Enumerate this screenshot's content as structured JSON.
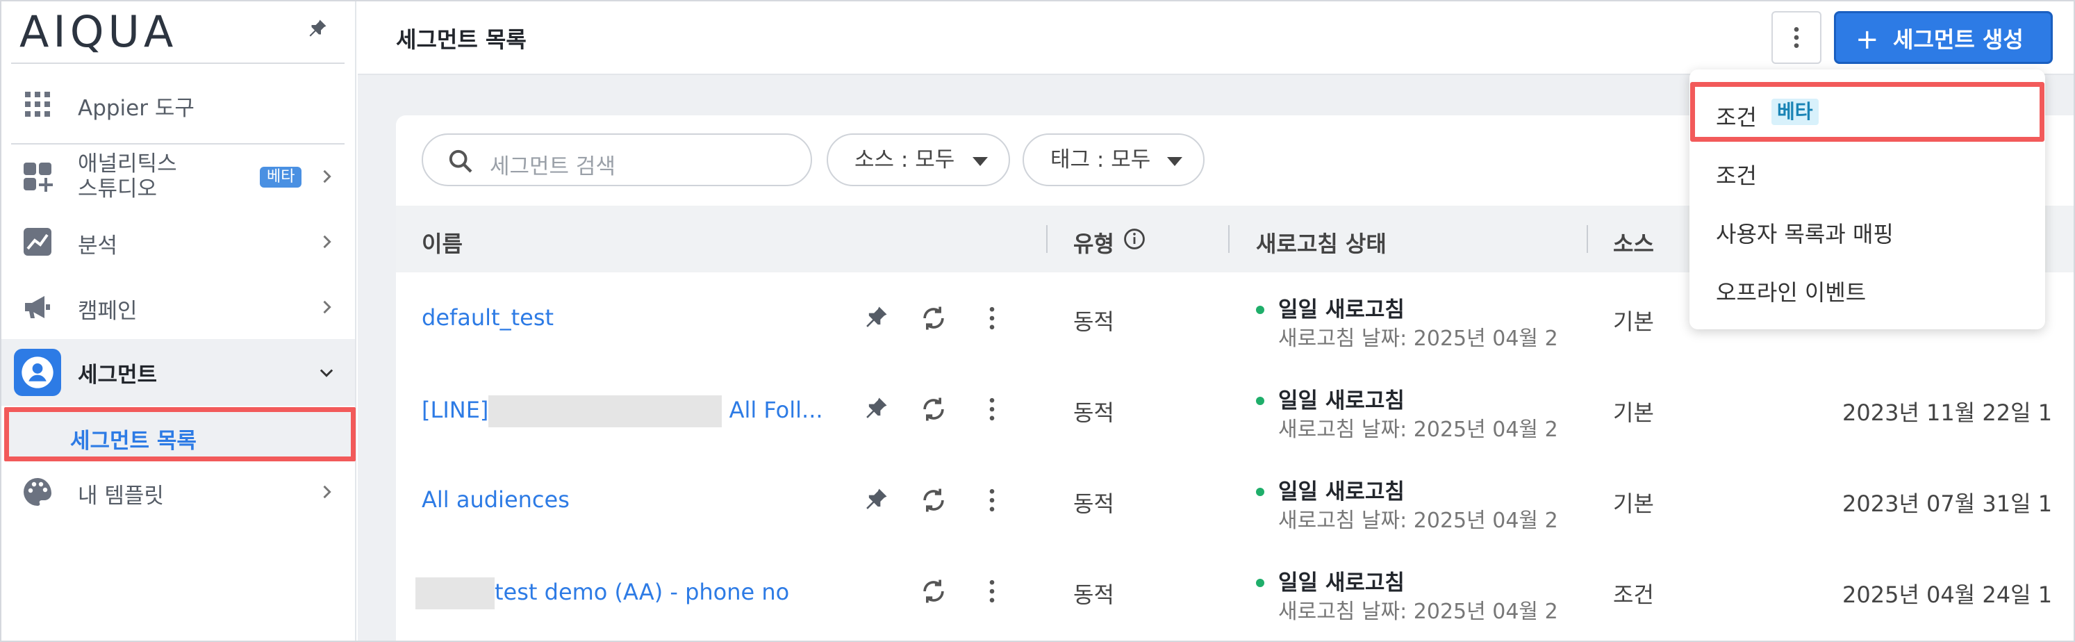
{
  "app": {
    "logo": "AIQUA"
  },
  "sidebar": {
    "items": [
      {
        "label": "Appier 도구"
      },
      {
        "label_line1": "애널리틱스",
        "label_line2": "스튜디오",
        "badge": "베타"
      },
      {
        "label": "분석"
      },
      {
        "label": "캠페인"
      },
      {
        "label": "세그먼트"
      },
      {
        "label": "내 템플릿"
      }
    ],
    "sub_items": [
      {
        "label": "세그먼트 목록"
      }
    ]
  },
  "header": {
    "title": "세그먼트 목록",
    "create_label": "세그먼트 생성",
    "create_icon": "+"
  },
  "filters": {
    "search_placeholder": "세그먼트 검색",
    "source": "소스 : 모두",
    "tag": "태그 : 모두"
  },
  "table": {
    "columns": [
      "이름",
      "유형",
      "새로고침 상태",
      "소스"
    ],
    "rows": [
      {
        "name": "default_test",
        "type": "동적",
        "status": "일일 새로고침",
        "date": "새로고침 날짜: 2025년 04월 2",
        "source": "기본",
        "created": ""
      },
      {
        "name_prefix": "[LINE]",
        "name_suffix": " All Foll...",
        "type": "동적",
        "status": "일일 새로고침",
        "date": "새로고침 날짜: 2025년 04월 2",
        "source": "기본",
        "created": "2023년 11월 22일 1"
      },
      {
        "name": "All audiences",
        "type": "동적",
        "status": "일일 새로고침",
        "date": "새로고침 날짜: 2025년 04월 2",
        "source": "기본",
        "created": "2023년 07월 31일 1"
      },
      {
        "name": "test demo (AA) - phone no",
        "type": "동적",
        "status": "일일 새로고침",
        "date": "새로고침 날짜: 2025년 04월 2",
        "source": "조건",
        "created": "2025년 04월 24일 1"
      }
    ]
  },
  "dropdown": {
    "items": [
      {
        "label": "조건",
        "badge": "베타"
      },
      {
        "label": "조건"
      },
      {
        "label": "사용자 목록과 매핑"
      },
      {
        "label": "오프라인 이벤트"
      }
    ]
  },
  "colors": {
    "accent": "#2d7be5",
    "highlight": "#f25a5a",
    "status_dot": "#1fae6a"
  },
  "icons": [
    "pin-icon",
    "grid-icon",
    "analytics-icon",
    "chart-icon",
    "megaphone-icon",
    "user-icon",
    "palette-icon",
    "chevron-right-icon",
    "chevron-down-icon",
    "search-icon",
    "info-icon",
    "refresh-icon",
    "kebab-icon"
  ]
}
